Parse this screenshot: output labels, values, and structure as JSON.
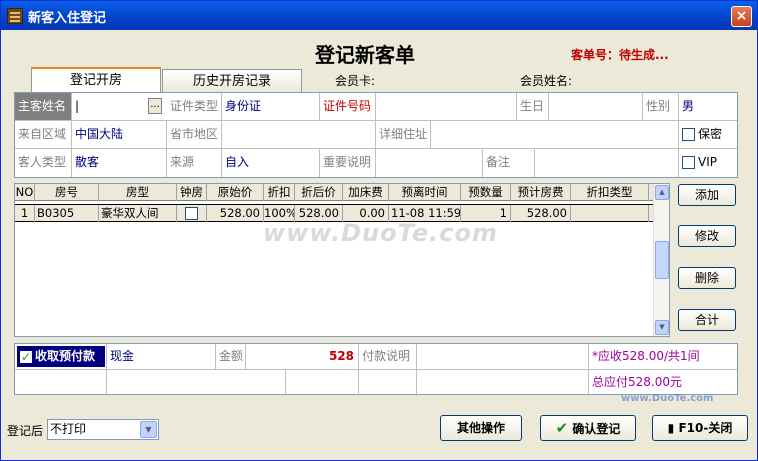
{
  "window": {
    "title": "新客入住登记",
    "close_label": "×"
  },
  "header": {
    "form_title": "登记新客单",
    "order_no": "客单号：待生成..."
  },
  "tabs": [
    {
      "label": "登记开房"
    },
    {
      "label": "历史开房记录"
    }
  ],
  "member": {
    "card_label": "会员卡:",
    "name_label": "会员姓名:"
  },
  "form": {
    "guest_name_label": "主客姓名",
    "guest_name_value": "|",
    "ellipsis": "...",
    "id_type_label": "证件类型",
    "id_type_value": "身份证",
    "id_no_label": "证件号码",
    "birthday_label": "生日",
    "gender_label": "性别",
    "gender_value": "男",
    "region_label": "来自区域",
    "region_value": "中国大陆",
    "province_label": "省市地区",
    "address_label": "详细住址",
    "secret_label": "保密",
    "guest_type_label": "客人类型",
    "guest_type_value": "散客",
    "source_label": "来源",
    "source_value": "自入",
    "important_label": "重要说明",
    "remark_label": "备注",
    "vip_label": "VIP"
  },
  "grid": {
    "columns": [
      "NO",
      "房号",
      "房型",
      "钟房",
      "原始价",
      "折扣",
      "折后价",
      "加床费",
      "预离时间",
      "预数量",
      "预计房费",
      "折扣类型"
    ],
    "rows": [
      {
        "no": "1",
        "room": "B0305",
        "type": "豪华双人间",
        "hourly": "",
        "orig_price": "528.00",
        "discount": "100%",
        "price": "528.00",
        "extra_bed": "0.00",
        "leave_time": "11-08 11:59",
        "qty": "1",
        "fee": "528.00",
        "discount_type": ""
      }
    ]
  },
  "side_buttons": {
    "add": "添加",
    "edit": "修改",
    "delete": "删除",
    "total": "合计"
  },
  "payment": {
    "prepay_label": "收取预付款",
    "method": "现金",
    "amount_label": "金额",
    "amount": "528",
    "desc_label": "付款说明",
    "receivable": "*应收528.00/共1间",
    "total_payable": "总应付528.00元"
  },
  "footer": {
    "after_label": "登记后",
    "print_option": "不打印",
    "other_ops": "其他操作",
    "confirm": "确认登记",
    "close": "F10-关闭"
  },
  "watermark": {
    "main": "www.DuoTe.com",
    "corner": "www.DuoTe.com"
  }
}
